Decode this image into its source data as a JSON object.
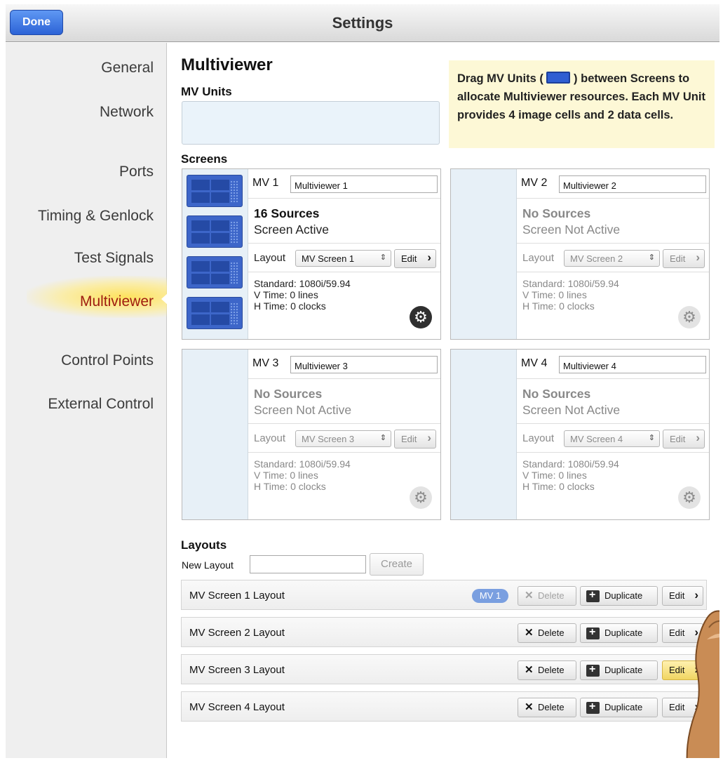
{
  "topbar": {
    "done_label": "Done",
    "title": "Settings"
  },
  "sidebar": {
    "items": [
      {
        "label": "General"
      },
      {
        "label": "Network"
      },
      {
        "label": "Ports"
      },
      {
        "label": "Timing & Genlock"
      },
      {
        "label": "Test Signals"
      },
      {
        "label": "Multiviewer",
        "active": true
      },
      {
        "label": "Control Points"
      },
      {
        "label": "External Control"
      }
    ]
  },
  "main": {
    "title": "Multiviewer",
    "mv_units_label": "MV Units",
    "hint": {
      "part1": "Drag MV Units (",
      "part2": ") between Screens to allocate Multiviewer resources. Each MV Unit provides 4 image cells and 2 data cells."
    },
    "screens_label": "Screens",
    "screens": [
      {
        "mv": "MV 1",
        "name": "Multiviewer 1",
        "sources": "16 Sources",
        "status": "Screen Active",
        "layout_label": "Layout",
        "layout": "MV Screen 1",
        "edit": "Edit",
        "standard": "Standard: 1080i/59.94",
        "vtime": "V Time: 0 lines",
        "htime": "H Time: 0 clocks",
        "units": 4
      },
      {
        "mv": "MV 2",
        "name": "Multiviewer 2",
        "sources": "No Sources",
        "status": "Screen Not Active",
        "layout_label": "Layout",
        "layout": "MV Screen 2",
        "edit": "Edit",
        "standard": "Standard: 1080i/59.94",
        "vtime": "V Time: 0 lines",
        "htime": "H Time: 0 clocks",
        "units": 0
      },
      {
        "mv": "MV 3",
        "name": "Multiviewer 3",
        "sources": "No Sources",
        "status": "Screen Not Active",
        "layout_label": "Layout",
        "layout": "MV Screen 3",
        "edit": "Edit",
        "standard": "Standard: 1080i/59.94",
        "vtime": "V Time: 0 lines",
        "htime": "H Time: 0 clocks",
        "units": 0
      },
      {
        "mv": "MV 4",
        "name": "Multiviewer 4",
        "sources": "No Sources",
        "status": "Screen Not Active",
        "layout_label": "Layout",
        "layout": "MV Screen 4",
        "edit": "Edit",
        "standard": "Standard: 1080i/59.94",
        "vtime": "V Time: 0 lines",
        "htime": "H Time: 0 clocks",
        "units": 0
      }
    ],
    "layouts_label": "Layouts",
    "new_layout_label": "New Layout",
    "new_layout_value": "",
    "create_label": "Create",
    "layouts": [
      {
        "name": "MV Screen 1 Layout",
        "badge": "MV 1",
        "delete": "Delete",
        "duplicate": "Duplicate",
        "edit": "Edit"
      },
      {
        "name": "MV Screen 2 Layout",
        "delete": "Delete",
        "duplicate": "Duplicate",
        "edit": "Edit"
      },
      {
        "name": "MV Screen 3 Layout",
        "delete": "Delete",
        "duplicate": "Duplicate",
        "edit": "Edit"
      },
      {
        "name": "MV Screen 4 Layout",
        "delete": "Delete",
        "duplicate": "Duplicate",
        "edit": "Edit"
      }
    ]
  },
  "colors": {
    "accent": "#2f5fd2",
    "active_nav": "#9e1b10",
    "hint_bg": "#fdf8d6"
  }
}
